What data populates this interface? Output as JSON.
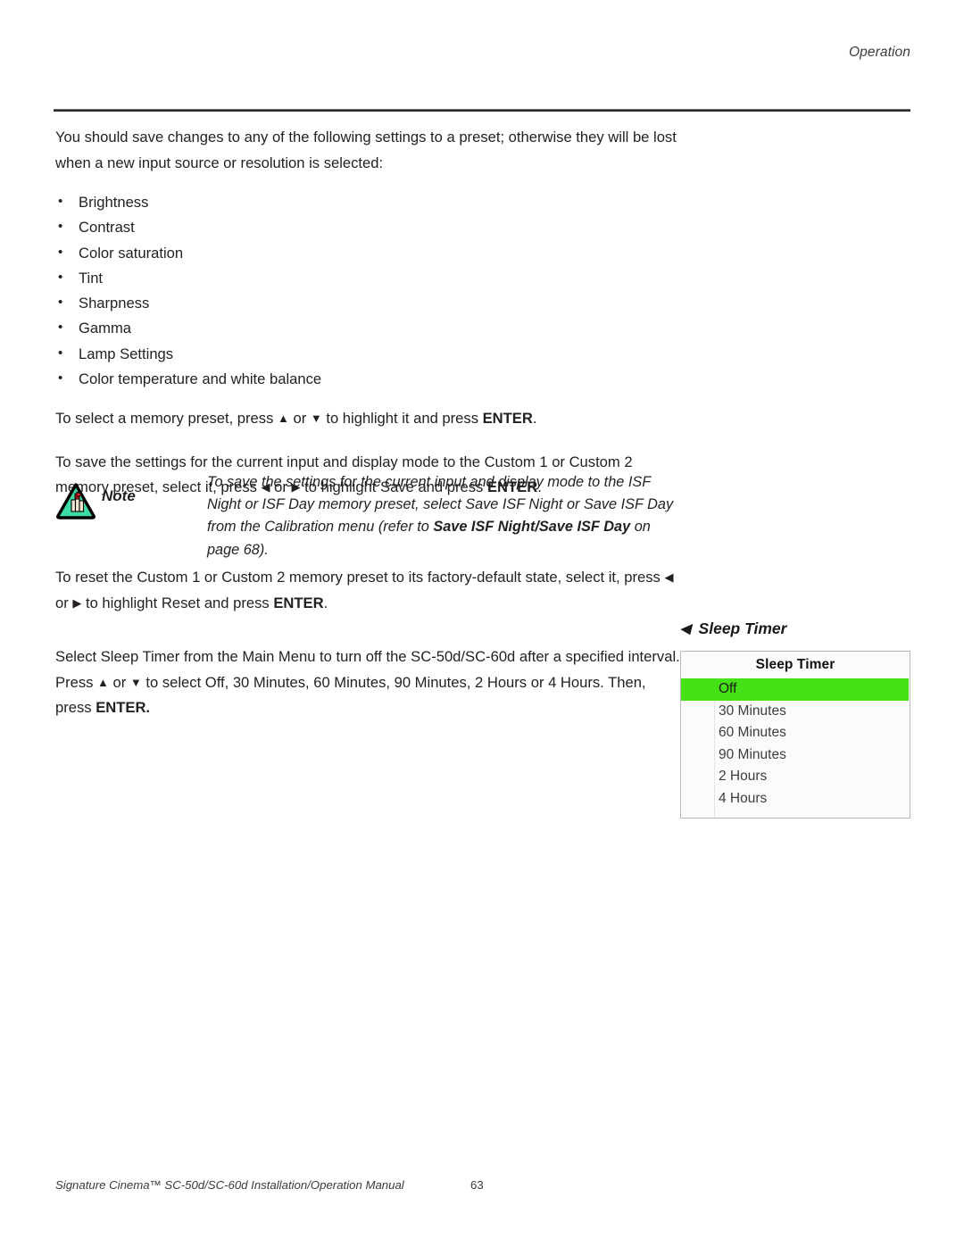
{
  "header": {
    "running_head": "Operation"
  },
  "intro": {
    "line1": "You should save changes to any of the following settings to a preset; otherwise they will",
    "line2": "be lost when a new input source or resolution is selected:"
  },
  "settings_list": [
    "Brightness",
    "Contrast",
    "Color saturation",
    "Tint",
    "Sharpness",
    "Gamma",
    "Lamp Settings",
    "Color temperature and white balance"
  ],
  "paragraphs": {
    "select_preset": {
      "pre": "To select a memory preset, press ",
      "key_up": "▲",
      "mid": " or ",
      "key_down": "▼",
      "post": " to highlight it and press ",
      "bold": "ENTER",
      "end": "."
    },
    "save_preset": {
      "pre": "To save the settings for the current input and display mode to the Custom 1 or Custom 2 memory preset, select it, press ",
      "key_left": "◀",
      "mid": " or ",
      "key_right": "▶",
      "post": " to highlight Save and press ",
      "bold": "ENTER",
      "end": "."
    },
    "reset_preset": {
      "pre": "To reset the Custom 1 or Custom 2 memory preset to its factory-default state, select it, press ",
      "key_left": "◀",
      "mid": " or ",
      "key_right": "▶",
      "post": " to highlight Reset and press ",
      "bold": "ENTER",
      "end": "."
    },
    "sleep_timer": {
      "pre": "Select Sleep Timer from the Main Menu to turn off the SC-50d/SC-60d after a specified interval. Press ",
      "key_up": "▲",
      "mid": " or ",
      "key_down": "▼",
      "post": " to select Off, 30 Minutes, 60 Minutes, 90 Minutes, 2 Hours or 4 Hours. Then, press ",
      "bold": "ENTER.",
      "end": ""
    }
  },
  "note": {
    "label": "Note",
    "icon": "note-triangle-hand-icon",
    "text_a": "To save the settings for the current input and display mode to the ISF Night or ISF Day memory preset, select Save ISF Night or Save ISF Day from the Calibration menu (refer to ",
    "text_bold": "Save ISF Night/Save ISF Day",
    "text_b": " on page 68)."
  },
  "figure": {
    "caption_arrow": "◀",
    "caption": "Sleep Timer",
    "osd": {
      "title": "Sleep Timer",
      "cursor_glyph": "‵",
      "items": [
        {
          "label": "Off",
          "selected": true
        },
        {
          "label": "30 Minutes",
          "selected": false
        },
        {
          "label": "60 Minutes",
          "selected": false
        },
        {
          "label": "90 Minutes",
          "selected": false
        },
        {
          "label": "2 Hours",
          "selected": false
        },
        {
          "label": "4 Hours",
          "selected": false
        }
      ],
      "highlight_color": "#44e216"
    }
  },
  "footer": {
    "manual_title": "Signature Cinema™ SC-50d/SC-60d Installation/Operation Manual",
    "page_number": "63"
  }
}
